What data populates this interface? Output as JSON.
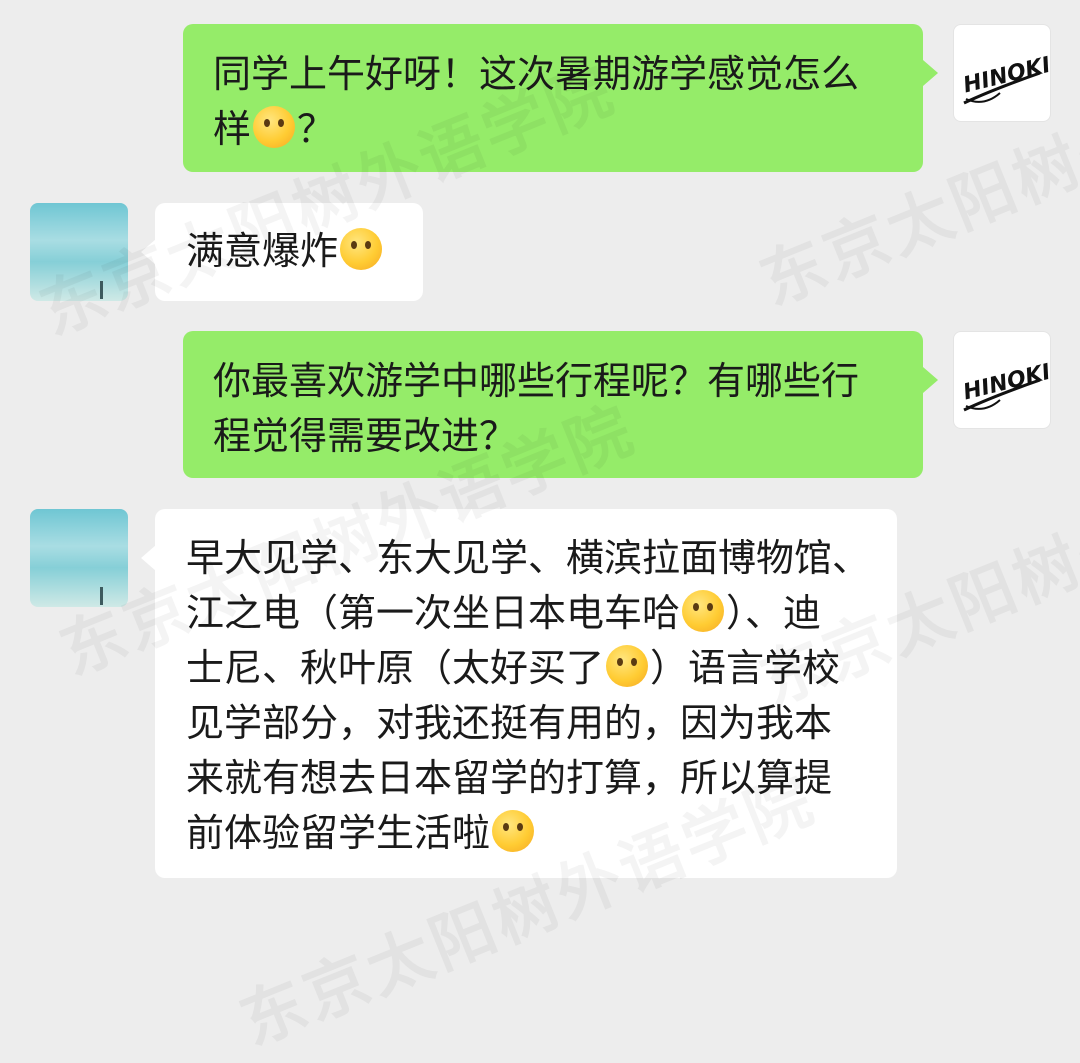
{
  "watermark": "东京太阳树外语学院",
  "messages": [
    {
      "side": "right",
      "text_a": "同学上午好呀！这次暑期游学感觉怎么",
      "text_b": "样",
      "text_c": "？",
      "emoji": "tongue-wink-emoji"
    },
    {
      "side": "left",
      "text_a": "满意爆炸",
      "emoji": "salute-emoji"
    },
    {
      "side": "right",
      "line1": "你最喜欢游学中哪些行程呢？有哪些行",
      "line2": "程觉得需要改进？"
    },
    {
      "side": "left",
      "p1": "早大见学、东大见学、横滨拉面博物馆、",
      "p2": "江之电（第一次坐日本电车哈",
      "p3": "）、迪",
      "p4": "士尼、秋叶原（太好买了",
      "p5": "）语言学校",
      "p6": "见学部分，对我还挺有用的，因为我本",
      "p7": "来就有想去日本留学的打算，所以算提",
      "p8": "前体验留学生活啦",
      "emojis": [
        "blush-emoji",
        "crying-emoji",
        "thinking-emoji"
      ]
    }
  ],
  "avatars": {
    "self_logo_text": "HINOKI",
    "other": "sky-photo-avatar"
  }
}
